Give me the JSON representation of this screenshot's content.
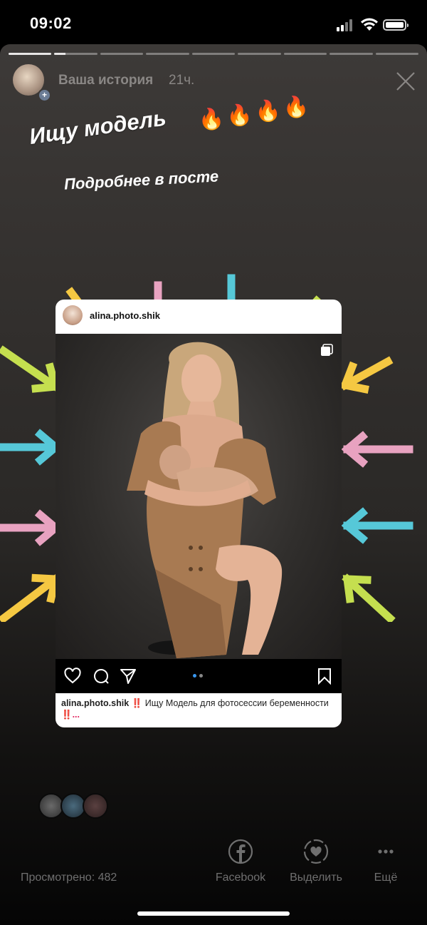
{
  "status_bar": {
    "time": "09:02"
  },
  "story": {
    "progress": {
      "segments": 9,
      "active_index": 1,
      "active_fill": 0.25
    },
    "header": {
      "title": "Ваша история",
      "time": "21ч."
    },
    "sticker": {
      "title": "Ищу модель",
      "flames": "🔥🔥🔥🔥",
      "subtitle": "Подробнее в посте"
    },
    "arrow_colors": [
      "#f5c842",
      "#e8a2c0",
      "#56c8d8",
      "#c5df4f"
    ],
    "post": {
      "username": "alina.photo.shik",
      "caption_user": "alina.photo.shik",
      "caption_marks": "‼️",
      "caption_text": "Ищу Модель для фотосессии беременности",
      "caption_end": "‼️...",
      "carousel": {
        "count": 2,
        "active": 0
      }
    },
    "footer": {
      "viewed_label": "Просмотрено: 482",
      "actions": [
        {
          "id": "facebook",
          "label": "Facebook",
          "icon": "facebook-icon"
        },
        {
          "id": "highlight",
          "label": "Выделить",
          "icon": "highlight-heart-icon"
        },
        {
          "id": "more",
          "label": "Ещё",
          "icon": "more-dots-icon"
        }
      ]
    }
  }
}
